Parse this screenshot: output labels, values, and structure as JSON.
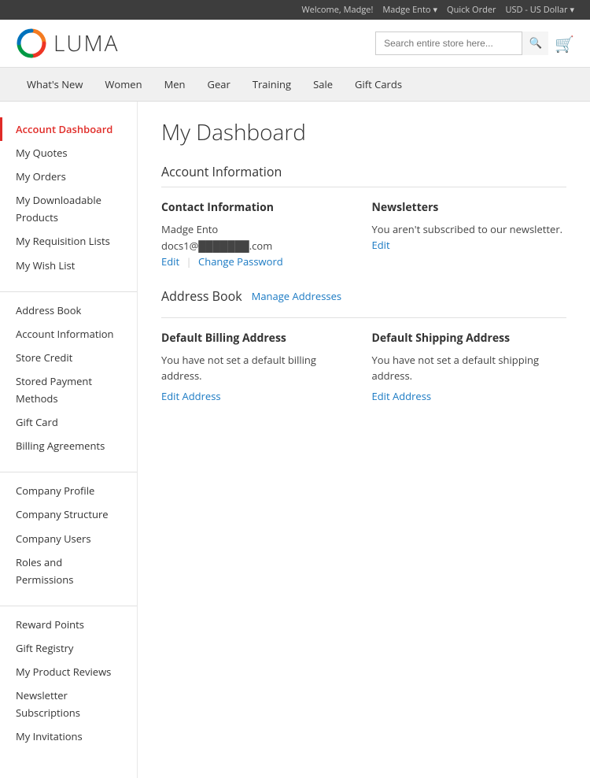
{
  "topbar": {
    "welcome": "Welcome, Madge!",
    "account": "Madge Ento",
    "quick_order": "Quick Order",
    "currency": "USD - US Dollar"
  },
  "header": {
    "logo_text": "LUMA",
    "search_placeholder": "Search entire store here...",
    "cart_label": "Cart"
  },
  "nav": {
    "items": [
      {
        "label": "What's New",
        "id": "whats-new"
      },
      {
        "label": "Women",
        "id": "women"
      },
      {
        "label": "Men",
        "id": "men"
      },
      {
        "label": "Gear",
        "id": "gear"
      },
      {
        "label": "Training",
        "id": "training"
      },
      {
        "label": "Sale",
        "id": "sale"
      },
      {
        "label": "Gift Cards",
        "id": "gift-cards"
      }
    ]
  },
  "sidebar": {
    "sections": [
      {
        "items": [
          {
            "label": "Account Dashboard",
            "id": "account-dashboard",
            "active": true
          },
          {
            "label": "My Quotes",
            "id": "my-quotes"
          },
          {
            "label": "My Orders",
            "id": "my-orders"
          },
          {
            "label": "My Downloadable Products",
            "id": "my-downloadable-products"
          },
          {
            "label": "My Requisition Lists",
            "id": "my-requisition-lists"
          },
          {
            "label": "My Wish List",
            "id": "my-wish-list"
          }
        ]
      },
      {
        "items": [
          {
            "label": "Address Book",
            "id": "address-book"
          },
          {
            "label": "Account Information",
            "id": "account-information"
          },
          {
            "label": "Store Credit",
            "id": "store-credit"
          },
          {
            "label": "Stored Payment Methods",
            "id": "stored-payment-methods"
          },
          {
            "label": "Gift Card",
            "id": "gift-card"
          },
          {
            "label": "Billing Agreements",
            "id": "billing-agreements"
          }
        ]
      },
      {
        "items": [
          {
            "label": "Company Profile",
            "id": "company-profile"
          },
          {
            "label": "Company Structure",
            "id": "company-structure"
          },
          {
            "label": "Company Users",
            "id": "company-users"
          },
          {
            "label": "Roles and Permissions",
            "id": "roles-and-permissions"
          }
        ]
      },
      {
        "items": [
          {
            "label": "Reward Points",
            "id": "reward-points"
          },
          {
            "label": "Gift Registry",
            "id": "gift-registry"
          },
          {
            "label": "My Product Reviews",
            "id": "my-product-reviews"
          },
          {
            "label": "Newsletter Subscriptions",
            "id": "newsletter-subscriptions"
          },
          {
            "label": "My Invitations",
            "id": "my-invitations"
          }
        ]
      }
    ]
  },
  "content": {
    "page_title": "My Dashboard",
    "account_info_section": "Account Information",
    "contact_info": {
      "heading": "Contact Information",
      "name": "Madge Ento",
      "email": "docs1@███████.com",
      "edit_label": "Edit",
      "change_password_label": "Change Password"
    },
    "newsletters": {
      "heading": "Newsletters",
      "text": "You aren't subscribed to our newsletter.",
      "edit_label": "Edit"
    },
    "address_book_section": "Address Book",
    "manage_addresses_label": "Manage Addresses",
    "billing": {
      "heading": "Default Billing Address",
      "text": "You have not set a default billing address.",
      "edit_label": "Edit Address"
    },
    "shipping": {
      "heading": "Default Shipping Address",
      "text": "You have not set a default shipping address.",
      "edit_label": "Edit Address"
    }
  }
}
